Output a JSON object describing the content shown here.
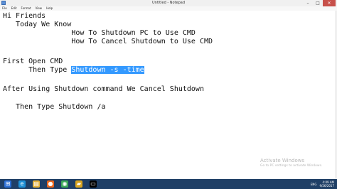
{
  "window": {
    "title": "Untitled - Notepad",
    "menus": [
      "File",
      "Edit",
      "Format",
      "View",
      "Help"
    ],
    "controls": {
      "minimize": "–",
      "maximize": "□",
      "close": "✕"
    }
  },
  "editor": {
    "lines": [
      "Hi Friends",
      "   Today We Know",
      "                How To Shutdown PC to Use CMD",
      "                How To Cancel Shutdown to Use CMD",
      "",
      "First Open CMD",
      "      Then Type ",
      "",
      "After Using Shutdown command We Cancel Shutdown",
      "",
      "   Then Type Shutdown /a"
    ],
    "selected_text": "Shutdown -s -time"
  },
  "watermark": {
    "title": "Activate Windows",
    "subtitle": "Go to PC settings to activate Windows."
  },
  "taskbar": {
    "icons": [
      "ie-icon",
      "file-explorer-icon",
      "firefox-icon",
      "chrome-icon",
      "folder-icon",
      "cmd-icon",
      "notepad-icon"
    ],
    "language": "ENG",
    "time": "4:09 AM",
    "date": "9/26/2017"
  },
  "colors": {
    "selection": "#3399ff",
    "taskbar": "#1f3f66",
    "close_button": "#c7504a"
  }
}
